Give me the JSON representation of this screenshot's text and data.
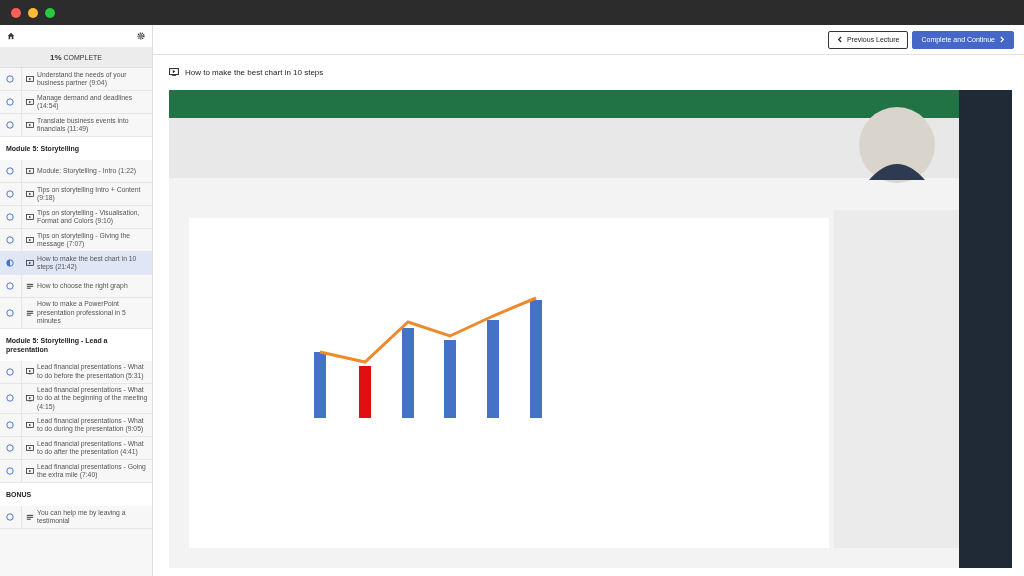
{
  "sidebar": {
    "progress": "1%",
    "progress_label": "COMPLETE",
    "sections": [
      {
        "items": [
          {
            "title": "Understand the needs of your business partner (9:04)",
            "kind": "video",
            "in_progress": false,
            "selected": false
          },
          {
            "title": "Manage demand and deadlines (14:54)",
            "kind": "video",
            "in_progress": false,
            "selected": false
          },
          {
            "title": "Translate business events into financials (11:49)",
            "kind": "video",
            "in_progress": false,
            "selected": false
          }
        ]
      },
      {
        "title": "Module 5: Storytelling",
        "items": [
          {
            "title": "Module: Storytelling - Intro (1:22)",
            "kind": "video",
            "in_progress": false,
            "selected": false
          },
          {
            "title": "Tips on storytelling Intro + Content (9:18)",
            "kind": "video",
            "in_progress": false,
            "selected": false
          },
          {
            "title": "Tips on storytelling - Visualisation, Format and Colors (9:10)",
            "kind": "video",
            "in_progress": false,
            "selected": false
          },
          {
            "title": "Tips on storytelling - Giving the message (7:07)",
            "kind": "video",
            "in_progress": false,
            "selected": false
          },
          {
            "title": "How to make the best chart in 10 steps (21:42)",
            "kind": "video",
            "in_progress": true,
            "selected": true
          },
          {
            "title": "How to choose the right graph",
            "kind": "text",
            "in_progress": false,
            "selected": false
          },
          {
            "title": "How to make a PowerPoint presentation professional in 5 minutes",
            "kind": "text",
            "in_progress": false,
            "selected": false
          }
        ]
      },
      {
        "title": "Module 5: Storytelling - Lead a presentation",
        "items": [
          {
            "title": "Lead financial presentations - What to do before the presentation (5:31)",
            "kind": "video",
            "in_progress": false,
            "selected": false
          },
          {
            "title": "Lead financial presentations - What to do at the beginning of the meeting (4:15)",
            "kind": "video",
            "in_progress": false,
            "selected": false
          },
          {
            "title": "Lead financial presentations - What to do during the presentation (9:05)",
            "kind": "video",
            "in_progress": false,
            "selected": false
          },
          {
            "title": "Lead financial presentations - What to do after the presentation (4:41)",
            "kind": "video",
            "in_progress": false,
            "selected": false
          },
          {
            "title": "Lead financial presentations - Going the extra mile (7:40)",
            "kind": "video",
            "in_progress": false,
            "selected": false
          }
        ]
      },
      {
        "title": "BONUS",
        "items": [
          {
            "title": "You can help me by leaving a testimonial",
            "kind": "text",
            "in_progress": false,
            "selected": false
          }
        ]
      }
    ]
  },
  "nav": {
    "previous": "Previous Lecture",
    "next": "Complete and Continue"
  },
  "lecture": {
    "title": "How to make the best chart in 10 steps"
  }
}
